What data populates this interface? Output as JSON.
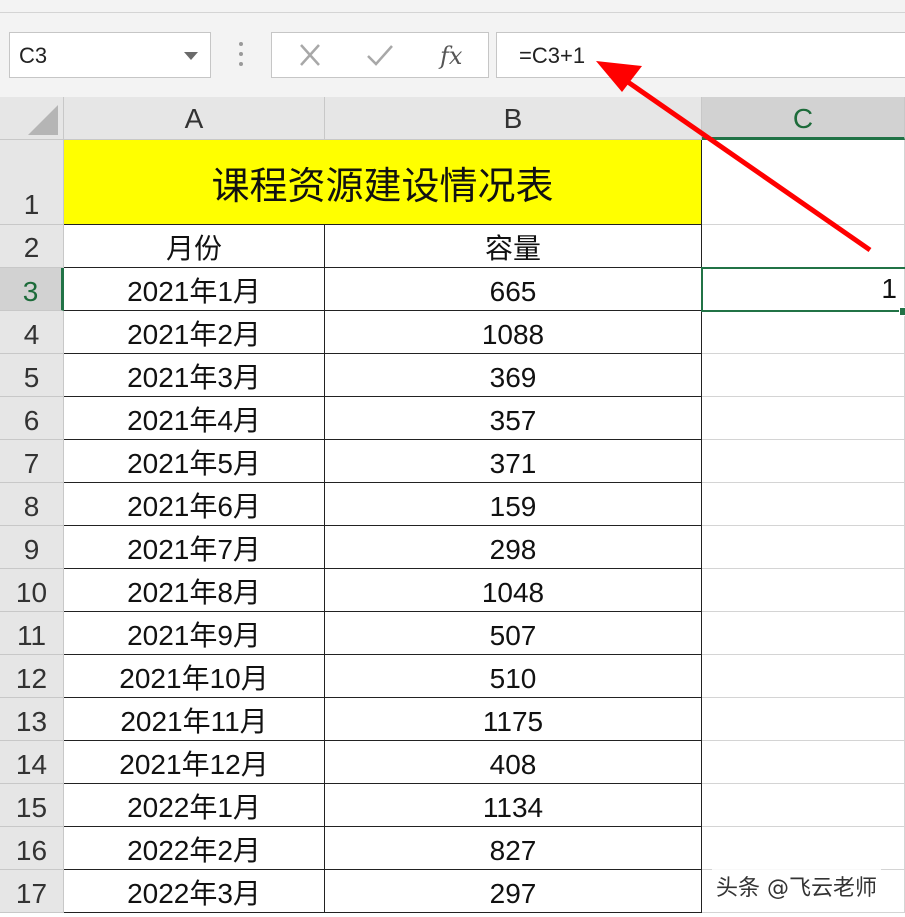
{
  "namebox": {
    "value": "C3"
  },
  "formula": {
    "cancel": "✕",
    "enter": "✓",
    "fx": "fx",
    "value": "=C3+1"
  },
  "columns": [
    {
      "id": "A",
      "label": "A"
    },
    {
      "id": "B",
      "label": "B"
    },
    {
      "id": "C",
      "label": "C"
    }
  ],
  "table": {
    "title": "课程资源建设情况表",
    "headers": {
      "month": "月份",
      "capacity": "容量"
    },
    "rows": [
      {
        "row": "3",
        "month": "2021年1月",
        "capacity": "665"
      },
      {
        "row": "4",
        "month": "2021年2月",
        "capacity": "1088"
      },
      {
        "row": "5",
        "month": "2021年3月",
        "capacity": "369"
      },
      {
        "row": "6",
        "month": "2021年4月",
        "capacity": "357"
      },
      {
        "row": "7",
        "month": "2021年5月",
        "capacity": "371"
      },
      {
        "row": "8",
        "month": "2021年6月",
        "capacity": "159"
      },
      {
        "row": "9",
        "month": "2021年7月",
        "capacity": "298"
      },
      {
        "row": "10",
        "month": "2021年8月",
        "capacity": "1048"
      },
      {
        "row": "11",
        "month": "2021年9月",
        "capacity": "507"
      },
      {
        "row": "12",
        "month": "2021年10月",
        "capacity": "510"
      },
      {
        "row": "13",
        "month": "2021年11月",
        "capacity": "1175"
      },
      {
        "row": "14",
        "month": "2021年12月",
        "capacity": "408"
      },
      {
        "row": "15",
        "month": "2022年1月",
        "capacity": "1134"
      },
      {
        "row": "16",
        "month": "2022年2月",
        "capacity": "827"
      },
      {
        "row": "17",
        "month": "2022年3月",
        "capacity": "297"
      }
    ]
  },
  "row_headers": [
    "1",
    "2"
  ],
  "active_cell": {
    "ref": "C3",
    "value": "1"
  },
  "watermark": "头条 @飞云老师",
  "colors": {
    "accent": "#217346",
    "title_fill": "#ffff00",
    "arrow": "#ff0000"
  }
}
